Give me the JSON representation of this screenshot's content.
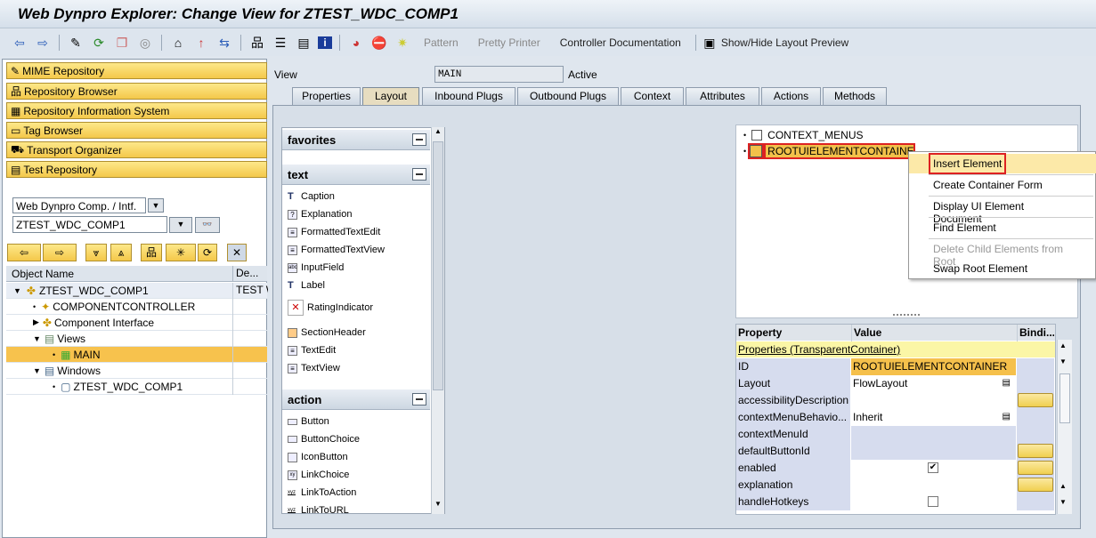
{
  "title": "Web Dynpro Explorer: Change View for ZTEST_WDC_COMP1",
  "toolbar": {
    "pattern": "Pattern",
    "pretty_printer": "Pretty Printer",
    "controller_doc": "Controller Documentation",
    "layout_preview": "Show/Hide Layout Preview"
  },
  "left": {
    "nav_buttons": [
      "MIME Repository",
      "Repository Browser",
      "Repository Information System",
      "Tag Browser",
      "Transport Organizer",
      "Test Repository"
    ],
    "object_type": "Web Dynpro Comp. / Intf.",
    "object_name": "ZTEST_WDC_COMP1",
    "columns": [
      "Object Name",
      "De..."
    ],
    "tree": [
      {
        "label": "ZTEST_WDC_COMP1",
        "desc": "TEST W",
        "icon": "component-icon"
      },
      {
        "label": "COMPONENTCONTROLLER",
        "desc": "",
        "icon": "controller-icon"
      },
      {
        "label": "Component Interface",
        "desc": "",
        "icon": "component-icon"
      },
      {
        "label": "Views",
        "desc": "",
        "icon": "folder-icon"
      },
      {
        "label": "MAIN",
        "desc": "",
        "icon": "view-icon"
      },
      {
        "label": "Windows",
        "desc": "",
        "icon": "folder-icon"
      },
      {
        "label": "ZTEST_WDC_COMP1",
        "desc": "",
        "icon": "window-icon"
      }
    ]
  },
  "view": {
    "label": "View",
    "name": "MAIN",
    "status": "Active"
  },
  "tabs": [
    "Properties",
    "Layout",
    "Inbound Plugs",
    "Outbound Plugs",
    "Context",
    "Attributes",
    "Actions",
    "Methods"
  ],
  "palette": {
    "favorites": "favorites",
    "text": "text",
    "text_items": [
      "Caption",
      "Explanation",
      "FormattedTextEdit",
      "FormattedTextView",
      "InputField",
      "Label",
      "RatingIndicator",
      "SectionHeader",
      "TextEdit",
      "TextView"
    ],
    "action": "action",
    "action_items": [
      "Button",
      "ButtonChoice",
      "IconButton",
      "LinkChoice",
      "LinkToAction",
      "LinkToURL"
    ]
  },
  "ui_tree": [
    "CONTEXT_MENUS",
    "ROOTUIELEMENTCONTAINER"
  ],
  "context_menu": [
    "Insert Element",
    "Create Container Form",
    "Display UI Element Document",
    "Find Element",
    "Delete Child Elements from Root",
    "Swap Root Element"
  ],
  "properties": {
    "headers": [
      "Property",
      "Value",
      "Bindi..."
    ],
    "section": "Properties (TransparentContainer)",
    "rows": [
      {
        "name": "ID",
        "value": "ROOTUIELEMENTCONTAINER"
      },
      {
        "name": "Layout",
        "value": "FlowLayout"
      },
      {
        "name": "accessibilityDescription",
        "value": ""
      },
      {
        "name": "contextMenuBehavio...",
        "value": "Inherit"
      },
      {
        "name": "contextMenuId",
        "value": ""
      },
      {
        "name": "defaultButtonId",
        "value": ""
      },
      {
        "name": "enabled",
        "value": "true"
      },
      {
        "name": "explanation",
        "value": ""
      },
      {
        "name": "handleHotkeys",
        "value": "false"
      }
    ]
  }
}
